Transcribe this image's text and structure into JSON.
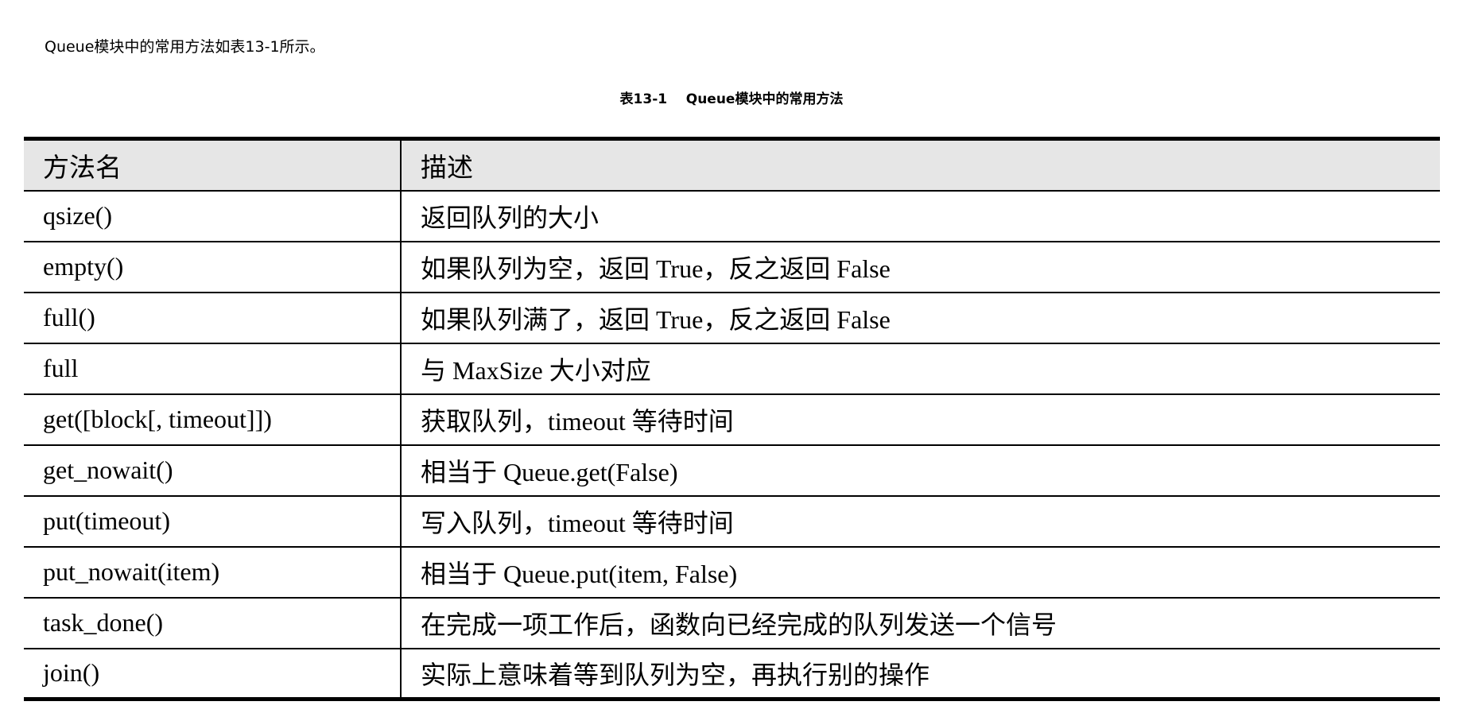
{
  "intro_text": "Queue模块中的常用方法如表13-1所示。",
  "table": {
    "caption": "表13-1    Queue模块中的常用方法",
    "headers": [
      "方法名",
      "描述"
    ],
    "rows": [
      {
        "method": "qsize()",
        "description": "返回队列的大小"
      },
      {
        "method": "empty()",
        "description": "如果队列为空，返回 True，反之返回 False"
      },
      {
        "method": "full()",
        "description": "如果队列满了，返回 True，反之返回 False"
      },
      {
        "method": "full",
        "description": "与 MaxSize 大小对应"
      },
      {
        "method": "get([block[, timeout]])",
        "description": "获取队列，timeout 等待时间"
      },
      {
        "method": "get_nowait()",
        "description": "相当于 Queue.get(False)"
      },
      {
        "method": "put(timeout)",
        "description": "写入队列，timeout 等待时间"
      },
      {
        "method": "put_nowait(item)",
        "description": "相当于 Queue.put(item, False)"
      },
      {
        "method": "task_done()",
        "description": "在完成一项工作后，函数向已经完成的队列发送一个信号"
      },
      {
        "method": "join()",
        "description": "实际上意味着等到队列为空，再执行别的操作"
      }
    ]
  }
}
